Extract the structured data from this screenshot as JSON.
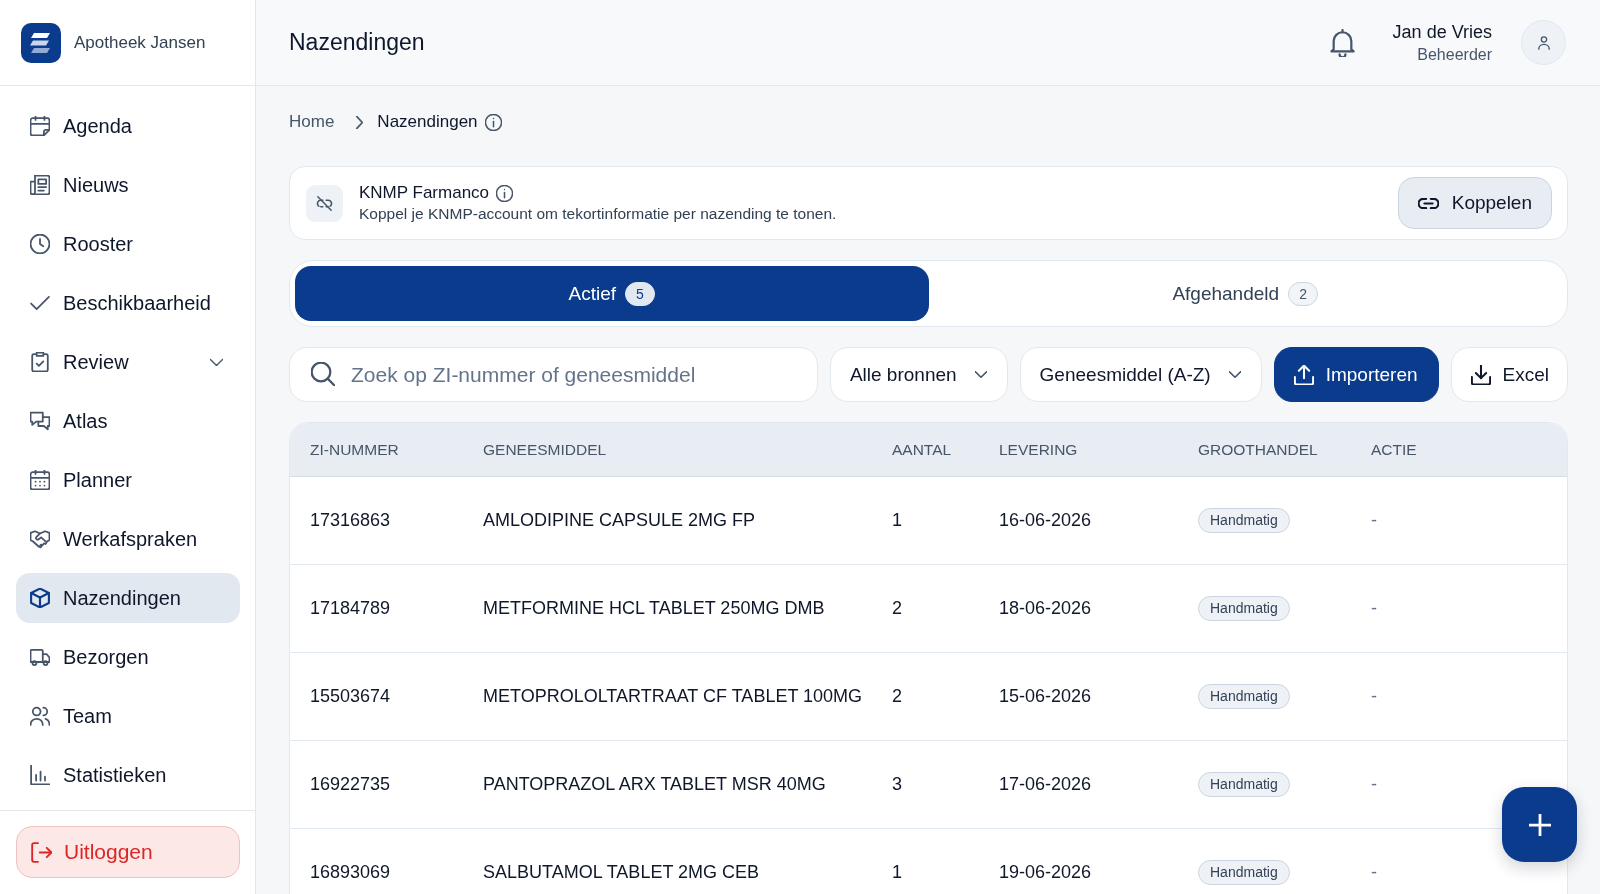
{
  "sidebar": {
    "brand": "Apotheek Jansen",
    "items": [
      {
        "label": "Agenda",
        "kind": "link",
        "selected": false
      },
      {
        "label": "Nieuws",
        "kind": "link",
        "selected": false
      },
      {
        "label": "Rooster",
        "kind": "link",
        "selected": false
      },
      {
        "label": "Beschikbaarheid",
        "kind": "link",
        "selected": false
      },
      {
        "label": "Review",
        "kind": "group",
        "expanded": false,
        "selected": false
      },
      {
        "label": "Atlas",
        "kind": "link",
        "selected": false
      },
      {
        "label": "Planner",
        "kind": "link",
        "selected": false
      },
      {
        "label": "Werkafspraken",
        "kind": "link",
        "selected": false
      },
      {
        "label": "Nazendingen",
        "kind": "link",
        "selected": true
      },
      {
        "label": "Bezorgen",
        "kind": "link",
        "selected": false
      },
      {
        "label": "Team",
        "kind": "link",
        "selected": false
      },
      {
        "label": "Statistieken",
        "kind": "link",
        "selected": false
      }
    ],
    "logout": "Uitloggen"
  },
  "header": {
    "title": "Nazendingen",
    "user": {
      "name": "Jan de Vries",
      "role": "Beheerder"
    }
  },
  "breadcrumb": [
    {
      "label": "Home",
      "current": false
    },
    {
      "label": "Nazendingen",
      "current": true
    }
  ],
  "integration": {
    "title": "KNMP Farmanco",
    "description": "Koppel je KNMP-account om tekortinformatie per nazending te tonen.",
    "button": "Koppelen"
  },
  "tabs": [
    {
      "label": "Actief",
      "count": "5",
      "selected": true
    },
    {
      "label": "Afgehandeld",
      "count": "2",
      "selected": false
    }
  ],
  "toolbar": {
    "search": {
      "placeholder": "Zoek op ZI-nummer of geneesmiddel"
    },
    "dropdowns": [
      {
        "value": "Alle bronnen"
      },
      {
        "value": "Geneesmiddel (A-Z)"
      }
    ],
    "buttons": [
      {
        "label": "Importeren",
        "kind": "primary"
      },
      {
        "label": "Excel",
        "kind": "secondary"
      }
    ]
  },
  "table": {
    "columns": [
      "ZI-NUMMER",
      "GENEESMIDDEL",
      "AANTAL",
      "LEVERING",
      "GROOTHANDEL",
      "ACTIE"
    ],
    "rows": [
      {
        "zi_nummer": "17316863",
        "geneesmiddel": "AMLODIPINE CAPSULE 2MG FP",
        "aantal": "1",
        "levering": "16-06-2026",
        "groothandel": "Handmatig",
        "actie": "-"
      },
      {
        "zi_nummer": "17184789",
        "geneesmiddel": "METFORMINE HCL TABLET 250MG DMB",
        "aantal": "2",
        "levering": "18-06-2026",
        "groothandel": "Handmatig",
        "actie": "-"
      },
      {
        "zi_nummer": "15503674",
        "geneesmiddel": "METOPROLOLTARTRAAT CF TABLET 100MG",
        "aantal": "2",
        "levering": "15-06-2026",
        "groothandel": "Handmatig",
        "actie": "-"
      },
      {
        "zi_nummer": "16922735",
        "geneesmiddel": "PANTOPRAZOL ARX TABLET MSR 40MG",
        "aantal": "3",
        "levering": "17-06-2026",
        "groothandel": "Handmatig",
        "actie": "-"
      },
      {
        "zi_nummer": "16893069",
        "geneesmiddel": "SALBUTAMOL TABLET 2MG CEB",
        "aantal": "1",
        "levering": "19-06-2026",
        "groothandel": "Handmatig",
        "actie": "-"
      }
    ]
  }
}
